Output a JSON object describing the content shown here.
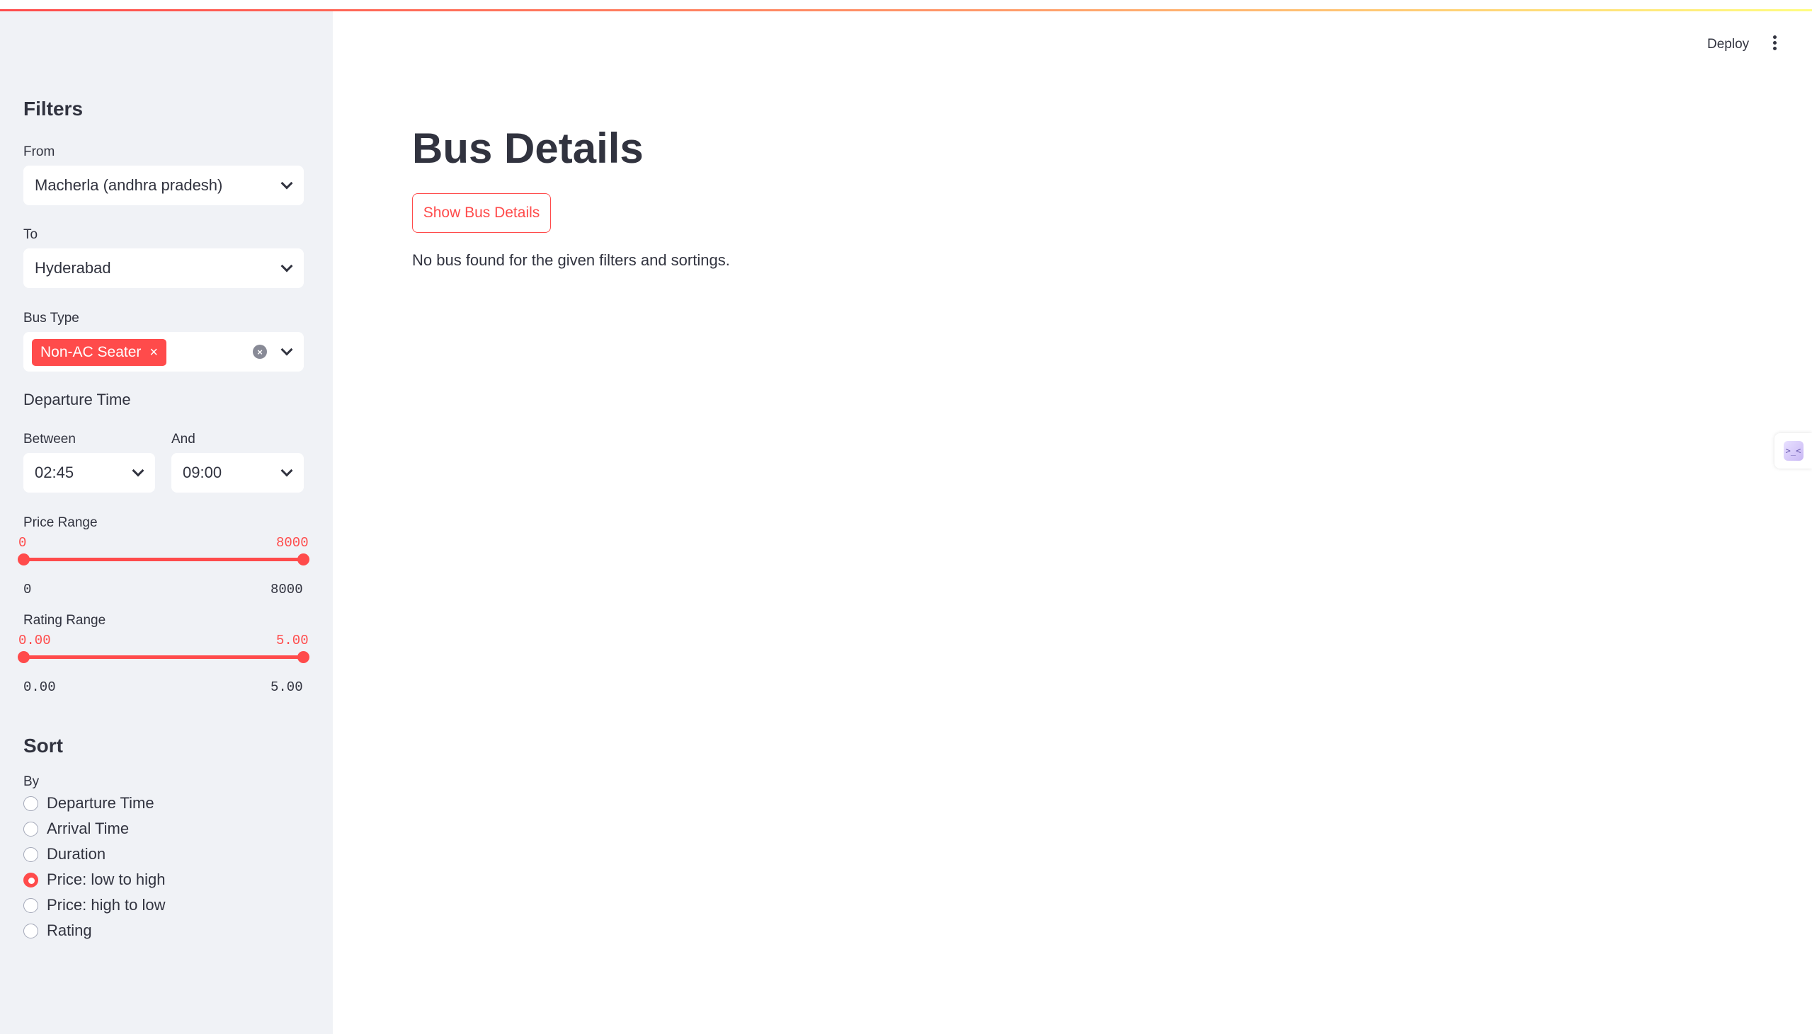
{
  "sidebar": {
    "filters_heading": "Filters",
    "from": {
      "label": "From",
      "value": "Macherla (andhra pradesh)"
    },
    "to": {
      "label": "To",
      "value": "Hyderabad"
    },
    "bus_type": {
      "label": "Bus Type",
      "tags": [
        "Non-AC Seater"
      ],
      "tag_remove": "×"
    },
    "departure": {
      "heading": "Departure Time",
      "between_label": "Between",
      "between_value": "02:45",
      "and_label": "And",
      "and_value": "09:00"
    },
    "price_range": {
      "label": "Price Range",
      "low": "0",
      "high": "8000",
      "min": "0",
      "max": "8000"
    },
    "rating_range": {
      "label": "Rating Range",
      "low": "0.00",
      "high": "5.00",
      "min": "0.00",
      "max": "5.00"
    },
    "sort": {
      "heading": "Sort",
      "by_label": "By",
      "options": [
        {
          "label": "Departure Time",
          "selected": false
        },
        {
          "label": "Arrival Time",
          "selected": false
        },
        {
          "label": "Duration",
          "selected": false
        },
        {
          "label": "Price: low to high",
          "selected": true
        },
        {
          "label": "Price: high to low",
          "selected": false
        },
        {
          "label": "Rating",
          "selected": false
        }
      ]
    }
  },
  "header": {
    "deploy_label": "Deploy",
    "menu_icon": "kebab-menu-icon"
  },
  "main": {
    "title": "Bus Details",
    "show_button": "Show Bus Details",
    "message": "No bus found for the given filters and sortings."
  },
  "colors": {
    "accent": "#ff4b4b",
    "sidebar_bg": "#f0f2f6",
    "text": "#31333f"
  }
}
